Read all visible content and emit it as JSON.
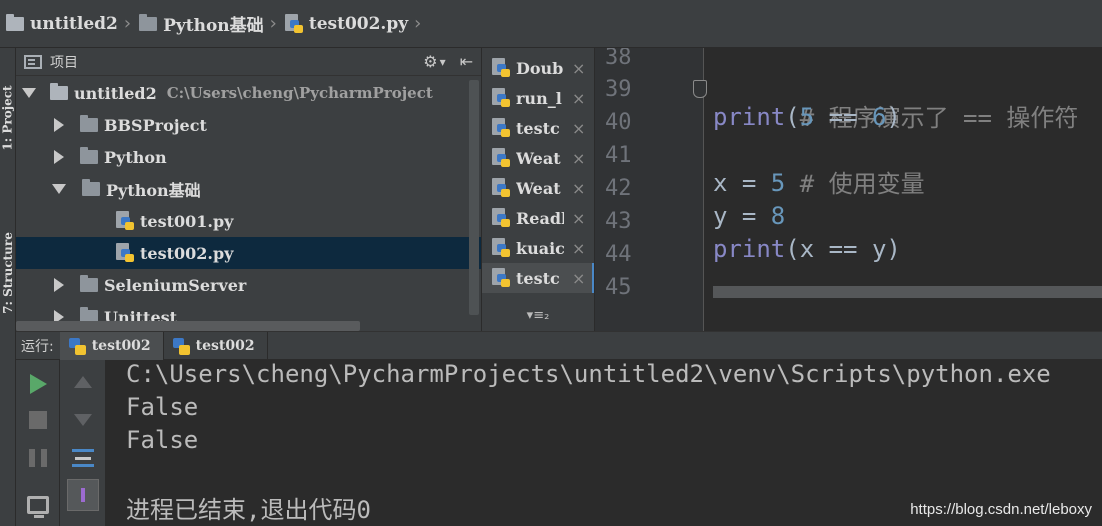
{
  "breadcrumb": {
    "project": "untitled2",
    "folder": "Python基础",
    "file": "test002.py"
  },
  "left_strip": {
    "project_tab": "1: Project",
    "structure_tab": "7: Structure"
  },
  "project_panel": {
    "header_label": "项目",
    "tools": {
      "settings": "⚙",
      "dropdown": "▾",
      "collapse": "⇤"
    },
    "root": {
      "name": "untitled2",
      "path": "C:\\Users\\cheng\\PycharmProject"
    },
    "items": [
      {
        "name": "BBSProject",
        "type": "folder",
        "expanded": false
      },
      {
        "name": "Python",
        "type": "folder",
        "expanded": false
      },
      {
        "name": "Python基础",
        "type": "folder",
        "expanded": true
      },
      {
        "name": "test001.py",
        "type": "python-file"
      },
      {
        "name": "test002.py",
        "type": "python-file",
        "selected": true
      },
      {
        "name": "SeleniumServer",
        "type": "folder",
        "expanded": false
      },
      {
        "name": "Unittest",
        "type": "folder",
        "expanded": false
      }
    ]
  },
  "open_files": {
    "items": [
      "Doub",
      "run_l",
      "testc",
      "Weat",
      "Weat",
      "Readl",
      "kuaic",
      "testc"
    ],
    "close_glyph": "×",
    "more_label": "▾≡₂"
  },
  "editor": {
    "line_numbers": [
      "38",
      "39",
      "40",
      "41",
      "42",
      "43",
      "44",
      "45"
    ],
    "code": {
      "l39_comment": "# 程序演示了 == 操作符",
      "l40_fn": "print",
      "l40_open": "(",
      "l40_a": "5",
      "l40_op": " == ",
      "l40_b": "6",
      "l40_close": ")",
      "l41_comment": "# 使用变量",
      "l42_var": "x = ",
      "l42_val": "5",
      "l43_var": "y = ",
      "l43_val": "8",
      "l44_fn": "print",
      "l44_rest": "(x == y)"
    }
  },
  "run_panel": {
    "label": "运行:",
    "tabs": [
      "test002",
      "test002"
    ],
    "console": [
      "C:\\Users\\cheng\\PycharmProjects\\untitled2\\venv\\Scripts\\python.exe",
      "False",
      "False",
      "",
      "进程已结束,退出代码0"
    ]
  },
  "watermark": "https://blog.csdn.net/leboxy"
}
